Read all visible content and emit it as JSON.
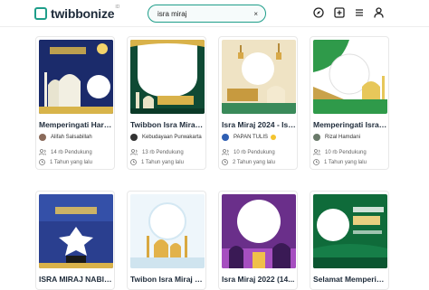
{
  "app": {
    "name": "twibbonize",
    "superscript": "ID"
  },
  "search": {
    "value": "isra miraj",
    "clear_label": "×"
  },
  "nav": {
    "icons": [
      "compass-icon",
      "add-square-icon",
      "menu-icon",
      "user-icon"
    ]
  },
  "cards": [
    {
      "title": "Memperingati Hari ...",
      "author": "Alifah Salsabillah",
      "supporters": "14 rb Pendukung",
      "time": "1 Tahun yang lalu",
      "verified": false
    },
    {
      "title": "Twibbon Isra Miraj ...",
      "author": "Kebudayaan Purwakarta",
      "supporters": "13 rb Pendukung",
      "time": "1 Tahun yang lalu",
      "verified": false
    },
    {
      "title": "Isra Miraj 2024 - Isr...",
      "author": "PAPAN TULIS",
      "supporters": "10 rb Pendukung",
      "time": "2 Tahun yang lalu",
      "verified": true
    },
    {
      "title": "Memperingati Isra ...",
      "author": "Rizal Hamdani",
      "supporters": "10 rb Pendukung",
      "time": "1 Tahun yang lalu",
      "verified": false
    },
    {
      "title": "ISRA MIRAJ NABI M..."
    },
    {
      "title": "Twibon Isra Miraj T..."
    },
    {
      "title": "Isra Miraj 2022 (14..."
    },
    {
      "title": "Selamat Memperin..."
    }
  ],
  "colors": {
    "accent": "#1f9e8a",
    "navy": "#1e2b3a"
  }
}
